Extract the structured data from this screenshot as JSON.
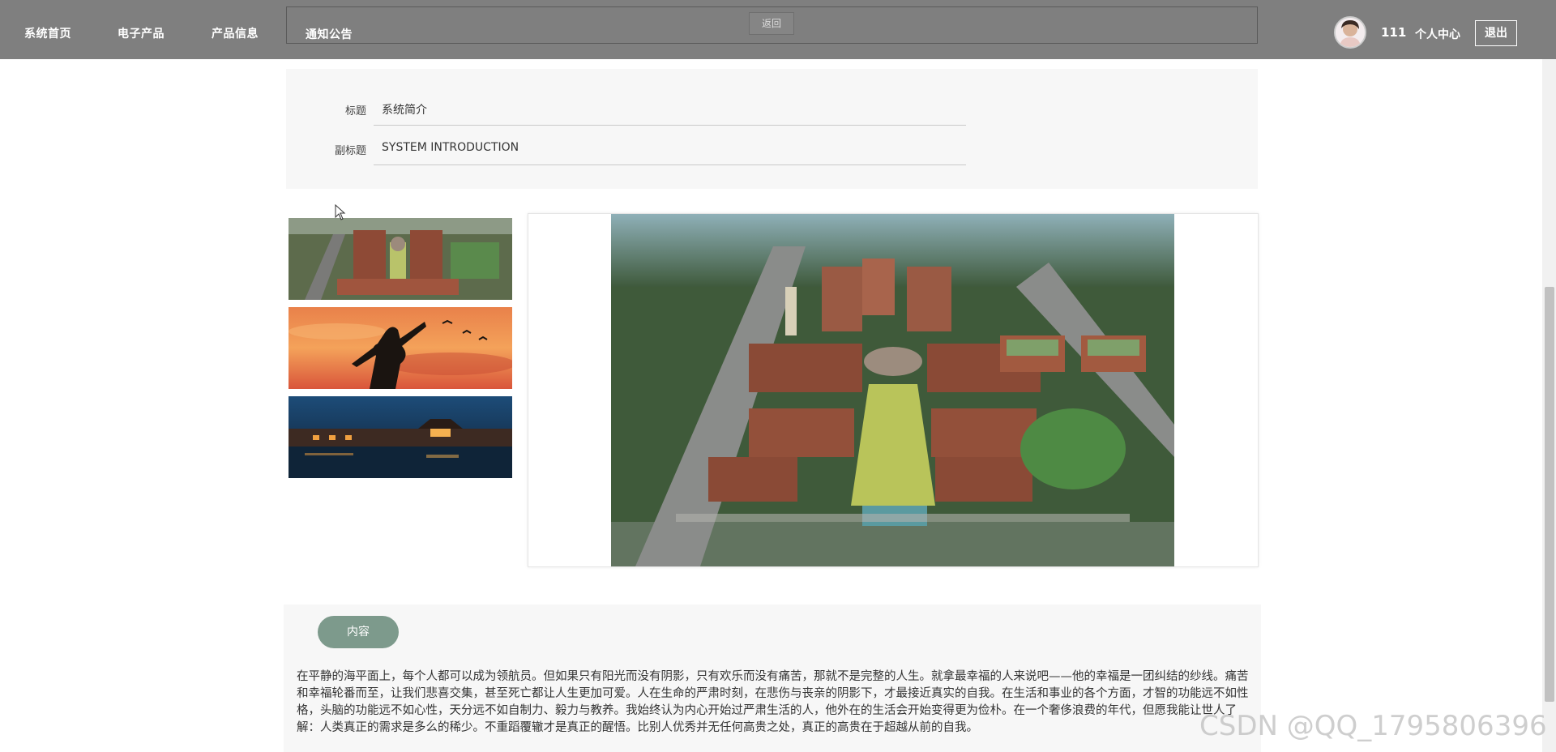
{
  "nav": {
    "items": [
      {
        "label": "系统首页"
      },
      {
        "label": "电子产品"
      },
      {
        "label": "产品信息"
      },
      {
        "label": "通知公告"
      }
    ],
    "back_label": "返回",
    "username": "111",
    "user_center_label": "个人中心",
    "logout_label": "退出"
  },
  "form": {
    "title_label": "标题",
    "title_value": "系统简介",
    "subtitle_label": "副标题",
    "subtitle_value": "SYSTEM INTRODUCTION"
  },
  "content": {
    "tab_label": "内容",
    "text": "在平静的海平面上，每个人都可以成为领航员。但如果只有阳光而没有阴影，只有欢乐而没有痛苦，那就不是完整的人生。就拿最幸福的人来说吧——他的幸福是一团纠结的纱线。痛苦和幸福轮番而至，让我们悲喜交集，甚至死亡都让人生更加可爱。人在生命的严肃时刻，在悲伤与丧亲的阴影下，才最接近真实的自我。在生活和事业的各个方面，才智的功能远不如性格，头脑的功能远不如心性，天分远不如自制力、毅力与教养。我始终认为内心开始过严肃生活的人，他外在的生活会开始变得更为俭朴。在一个奢侈浪费的年代，但愿我能让世人了解：人类真正的需求是多么的稀少。不重蹈覆辙才是真正的醒悟。比别人优秀并无任何高贵之处，真正的高贵在于超越从前的自我。"
  },
  "watermark": "CSDN @QQ_1795806396",
  "colors": {
    "topbar": "#7f7f7f",
    "tab_pill": "#7d9a8c",
    "panel_bg": "#f7f7f7"
  }
}
